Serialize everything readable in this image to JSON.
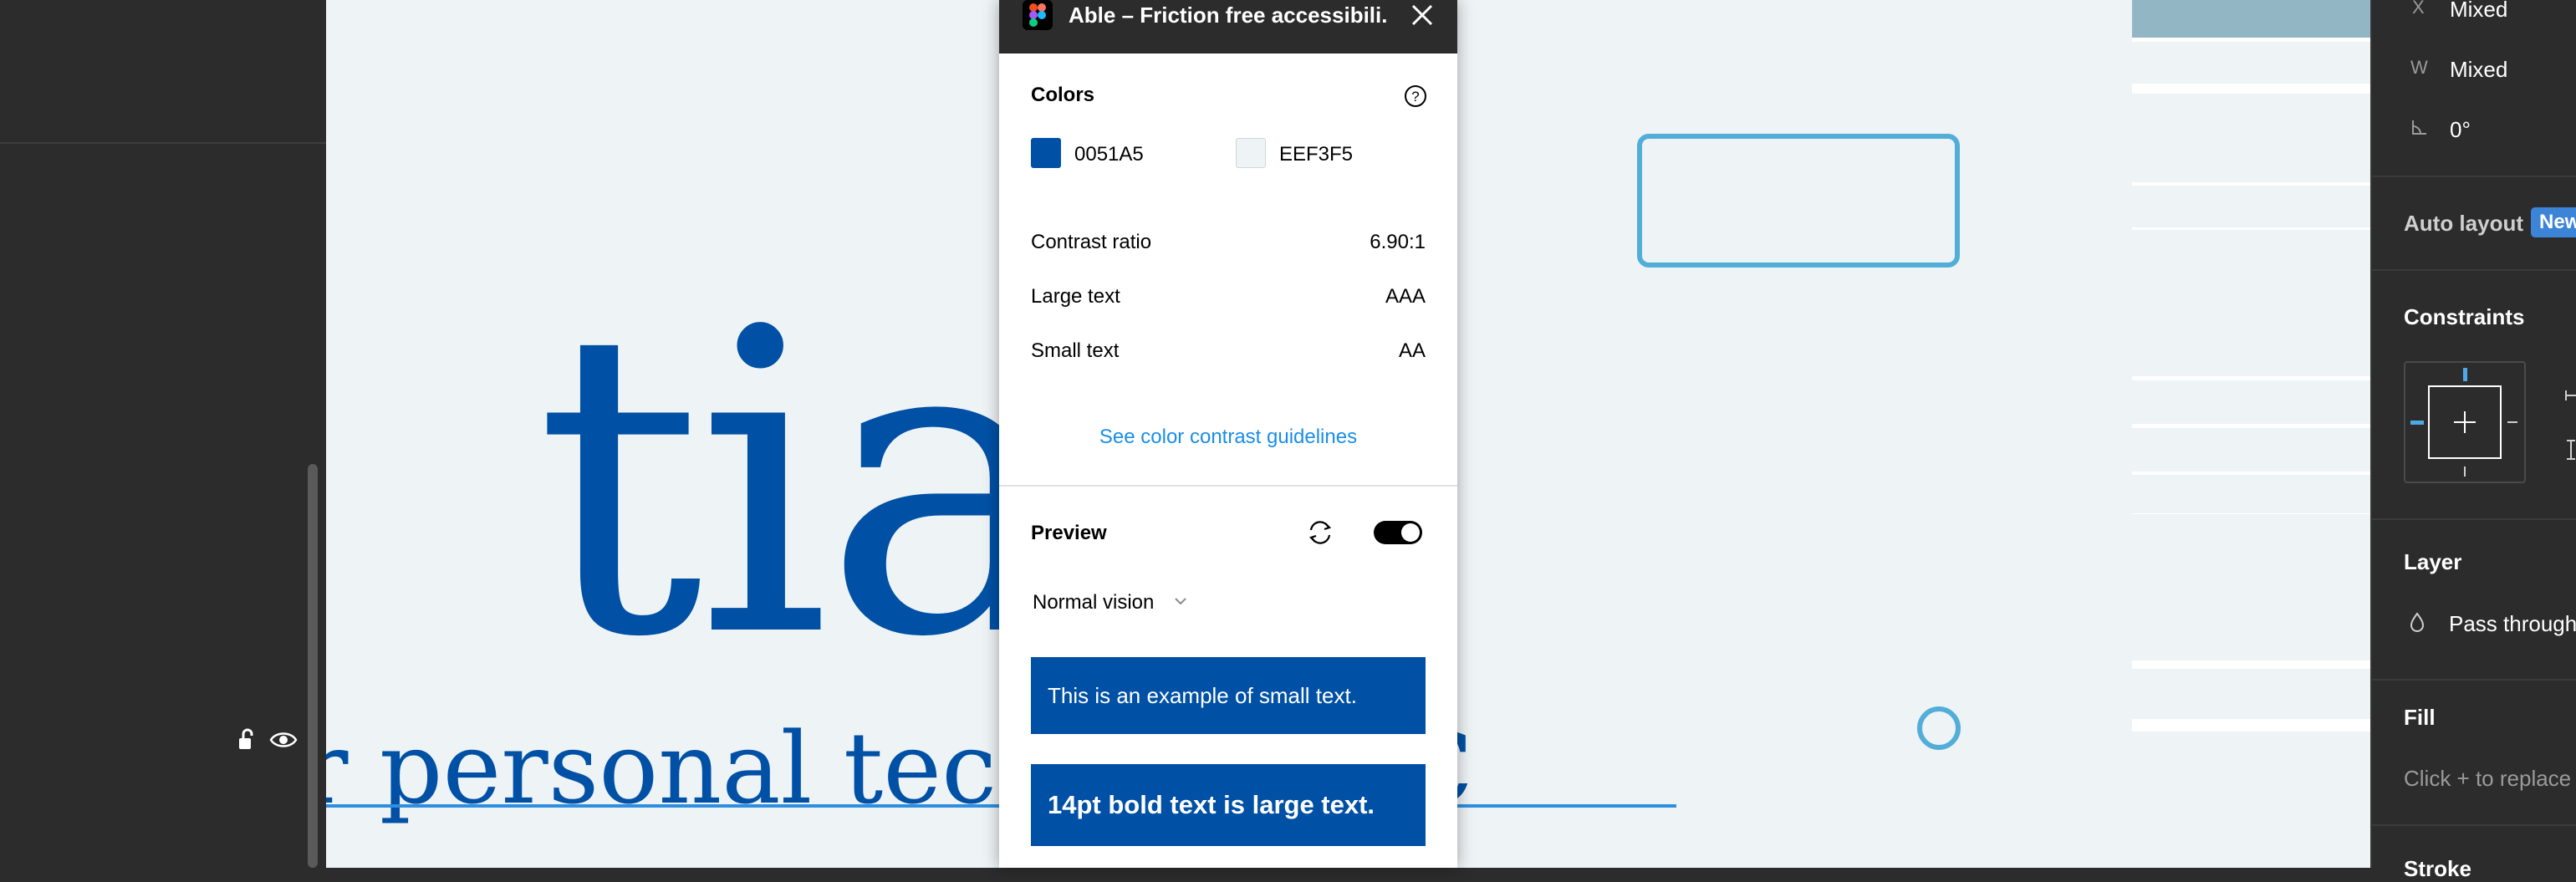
{
  "plugin": {
    "title": "Able – Friction free accessibili...",
    "colors_heading": "Colors",
    "color_fg": {
      "hex": "0051A5",
      "swatch": "#0051a5"
    },
    "color_bg": {
      "hex": "EEF3F5",
      "swatch": "#eef3f5"
    },
    "contrast": [
      {
        "label": "Contrast ratio",
        "value": "6.90:1"
      },
      {
        "label": "Large text",
        "value": "AAA"
      },
      {
        "label": "Small text",
        "value": "AA"
      }
    ],
    "guidelines_link": "See color contrast guidelines",
    "preview_heading": "Preview",
    "preview_toggle_on": true,
    "vision_mode": "Normal vision",
    "sample_small": "This is an example of small text.",
    "sample_large": "14pt bold text is large text."
  },
  "canvas": {
    "big_text": "tia",
    "sub_text": "r personal tech c                         t RBC"
  },
  "properties": {
    "x_label": "X",
    "x_value": "Mixed",
    "w_label": "W",
    "w_value": "Mixed",
    "rotation_value": "0°",
    "auto_layout": "Auto layout",
    "auto_layout_badge": "New",
    "constraints": "Constraints",
    "layer": "Layer",
    "blend_mode": "Pass through",
    "fill": "Fill",
    "fill_hint": "Click + to replace",
    "stroke": "Stroke"
  },
  "colors": {
    "brand_blue": "#0051a5",
    "canvas_bg": "#eef3f5",
    "selection_blue": "#52aed8",
    "link_blue": "#1a8ee8",
    "panel_dark": "#2c2c2c"
  }
}
